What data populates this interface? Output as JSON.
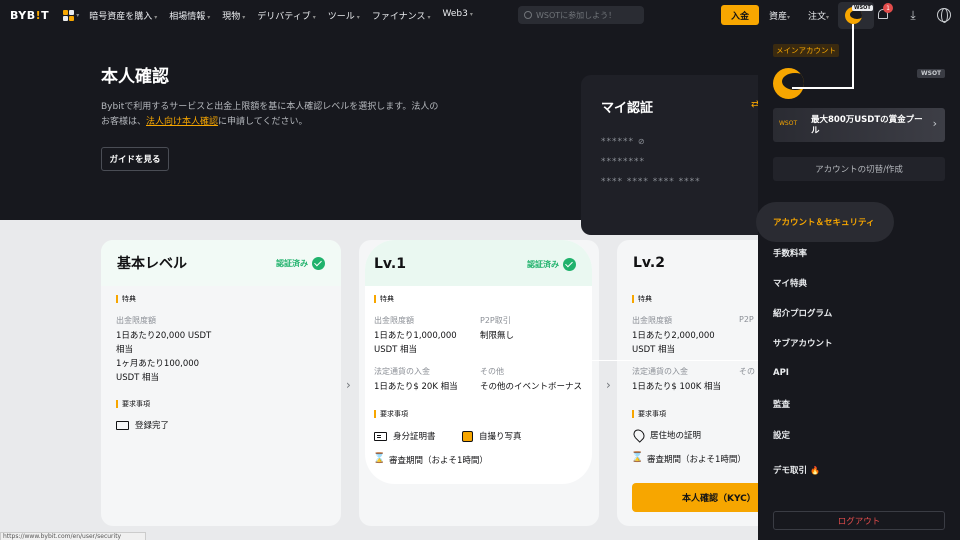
{
  "nav": {
    "logo": "BYB!T",
    "menu": [
      "暗号資産を購入",
      "相場情報",
      "現物",
      "デリバティブ",
      "ツール",
      "ファイナンス",
      "Web3"
    ],
    "search_placeholder": "WSOTに参加しよう！",
    "deposit": "入金",
    "assets": "資産",
    "orders": "注文",
    "avatar_tag": "WSOT",
    "notification_count": "1"
  },
  "hero": {
    "title": "本人確認",
    "desc1": "Bybitで利用するサービスと出金上限額を基に本人確認レベルを選択します。法人の",
    "desc2_pre": "お客様は、",
    "desc2_link": "法人向け本人確認",
    "desc2_post": "に申請してください。",
    "guide_button": "ガイドを見る",
    "my_cert": {
      "title": "マイ認証",
      "line1": "******",
      "line2": "********",
      "line3": "**** **** **** ****"
    }
  },
  "levels": [
    {
      "name": "基本レベル",
      "status": "認証済み",
      "benefits_label": "特典",
      "limit_label": "出金限度額",
      "limit_lines": [
        "1日あたり20,000 USDT",
        "相当",
        "1ヶ月あたり100,000",
        "USDT 相当"
      ],
      "req_label": "要求事項",
      "reqs": [
        "登録完了"
      ]
    },
    {
      "name": "Lv.1",
      "status": "認証済み",
      "benefits_label": "特典",
      "limit_label": "出金限度額",
      "limit_lines": [
        "1日あたり1,000,000",
        "USDT 相当"
      ],
      "p2p_label": "P2P取引",
      "p2p_value": "制限無し",
      "fiat_label": "法定通貨の入金",
      "fiat_value": "1日あたり$ 20K 相当",
      "other_label": "その他",
      "other_value": "その他のイベントボーナス",
      "req_label": "要求事項",
      "reqs": [
        "身分証明書",
        "自撮り写真",
        "審査期間（およそ1時間）"
      ]
    },
    {
      "name": "Lv.2",
      "benefits_label": "特典",
      "limit_label": "出金限度額",
      "limit_lines": [
        "1日あたり2,000,000",
        "USDT 相当"
      ],
      "p2p_label": "P2P",
      "fiat_label": "法定通貨の入金",
      "fiat_value": "1日あたり$ 100K 相当",
      "other_label": "その",
      "req_label": "要求事項",
      "reqs": [
        "居住地の証明",
        "審査期間（およそ1時間）"
      ],
      "button": "本人確認（KYC）"
    }
  ],
  "panel": {
    "main_account": "メインアカウント",
    "wsot": "WSOT",
    "banner_title": "最大800万USDTの賞金プール",
    "banner_icon_text": "WSOT",
    "switch": "アカウントの切替/作成",
    "items": [
      "アカウント＆セキュリティ",
      "手数料率",
      "マイ特典",
      "紹介プログラム",
      "サブアカウント",
      "API",
      "監査",
      "設定",
      "デモ取引"
    ],
    "logout": "ログアウト"
  },
  "status_url": "https://www.bybit.com/en/user/security"
}
